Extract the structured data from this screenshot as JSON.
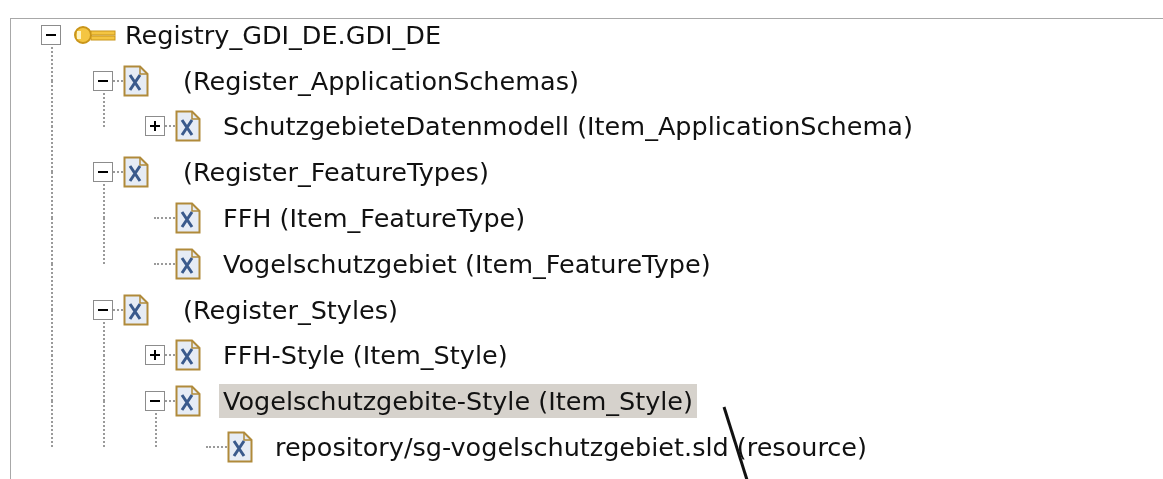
{
  "tree": {
    "label": "Registry_GDI_DE.GDI_DE",
    "kind": "registry",
    "expanded": true,
    "selected": false,
    "children": [
      {
        "label": "(Register_ApplicationSchemas)",
        "kind": "register",
        "expanded": true,
        "selected": false,
        "children": [
          {
            "label": "SchutzgebieteDatenmodell (Item_ApplicationSchema)",
            "kind": "item",
            "expanded": false,
            "selected": false
          }
        ]
      },
      {
        "label": "(Register_FeatureTypes)",
        "kind": "register",
        "expanded": true,
        "selected": false,
        "children": [
          {
            "label": "FFH (Item_FeatureType)",
            "kind": "item",
            "selected": false
          },
          {
            "label": "Vogelschutzgebiet (Item_FeatureType)",
            "kind": "item",
            "selected": false
          }
        ]
      },
      {
        "label": "(Register_Styles)",
        "kind": "register",
        "expanded": true,
        "selected": false,
        "children": [
          {
            "label": "FFH-Style (Item_Style)",
            "kind": "item",
            "expanded": false,
            "selected": false
          },
          {
            "label": "Vogelschutzgebite-Style (Item_Style)",
            "kind": "item",
            "expanded": true,
            "selected": true,
            "children": [
              {
                "label": "repository/sg-vogelschutzgebiet.sld (resource)",
                "kind": "resource",
                "selected": false
              }
            ]
          }
        ]
      }
    ]
  }
}
